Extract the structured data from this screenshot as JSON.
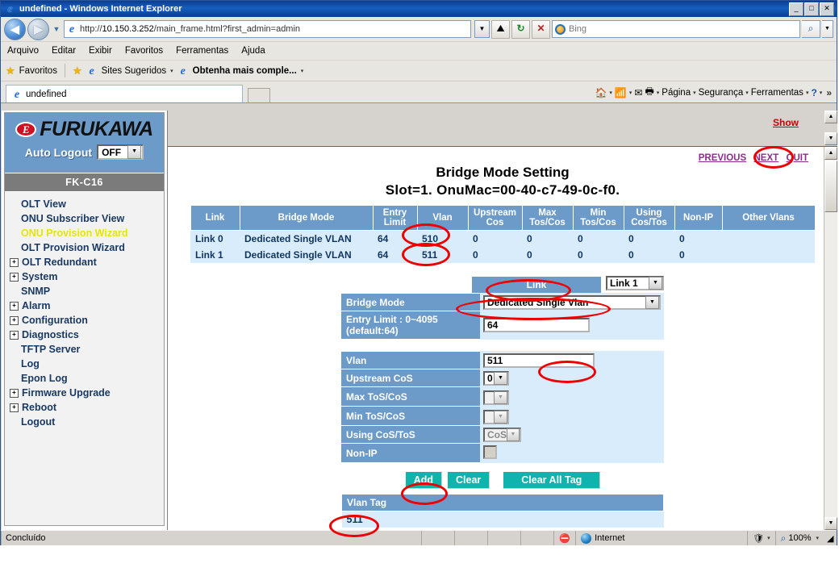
{
  "window": {
    "title": "undefined - Windows Internet Explorer",
    "buttons": {
      "minimize": "_",
      "maximize": "□",
      "close": "✕"
    }
  },
  "nav": {
    "back_glyph": "◀",
    "forward_glyph": "▶",
    "history_caret": "▼",
    "url_scheme": "http://",
    "url_host": "10.150.3.252",
    "url_path": "/main_frame.html?first_admin=admin",
    "address_caret": "▼",
    "compat_icon": "compatibility-view-icon",
    "refresh_glyph": "↻",
    "stop_glyph": "✕",
    "search_placeholder": "Bing",
    "search_go_glyph": "🔍",
    "search_caret": "▼"
  },
  "menubar": [
    {
      "label": "Arquivo",
      "accel": "A"
    },
    {
      "label": "Editar",
      "accel": "E"
    },
    {
      "label": "Exibir",
      "accel": "x"
    },
    {
      "label": "Favoritos",
      "accel": "F"
    },
    {
      "label": "Ferramentas",
      "accel": "r"
    },
    {
      "label": "Ajuda",
      "accel": "u"
    }
  ],
  "favbar": {
    "favorites_label": "Favoritos",
    "suggested_sites": "Sites Sugeridos",
    "get_more": "Obtenha mais comple...",
    "caret": "▾"
  },
  "tabs": {
    "active_label": "undefined",
    "new_tab_title": ""
  },
  "commandbar": {
    "home": "home-icon",
    "feeds": "feeds-icon",
    "read_mail": "mail-icon",
    "print": "print-icon",
    "page": "Página",
    "security": "Segurança",
    "tools": "Ferramentas",
    "help": "?",
    "overflow": "»",
    "caret": "▾"
  },
  "sidebar": {
    "brand": "FURUKAWA",
    "brand_badge": "E",
    "auto_logout_label": "Auto Logout",
    "auto_logout_value": "OFF",
    "model": "FK-C16",
    "items": [
      {
        "label": "OLT View",
        "expandable": false,
        "active": false
      },
      {
        "label": "ONU Subscriber View",
        "expandable": false,
        "active": false
      },
      {
        "label": "ONU Provision Wizard",
        "expandable": false,
        "active": true
      },
      {
        "label": "OLT Provision Wizard",
        "expandable": false,
        "active": false
      },
      {
        "label": "OLT Redundant",
        "expandable": true,
        "active": false
      },
      {
        "label": "System",
        "expandable": true,
        "active": false
      },
      {
        "label": "SNMP",
        "expandable": false,
        "active": false
      },
      {
        "label": "Alarm",
        "expandable": true,
        "active": false
      },
      {
        "label": "Configuration",
        "expandable": true,
        "active": false
      },
      {
        "label": "Diagnostics",
        "expandable": true,
        "active": false
      },
      {
        "label": "TFTP Server",
        "expandable": false,
        "active": false
      },
      {
        "label": "Log",
        "expandable": false,
        "active": false
      },
      {
        "label": "Epon Log",
        "expandable": false,
        "active": false
      },
      {
        "label": "Firmware Upgrade",
        "expandable": true,
        "active": false
      },
      {
        "label": "Reboot",
        "expandable": true,
        "active": false
      },
      {
        "label": "Logout",
        "expandable": false,
        "active": false
      }
    ]
  },
  "main": {
    "show_link": "Show",
    "pagelinks": {
      "previous": "PREVIOUS",
      "next": "NEXT",
      "quit": "QUIT"
    },
    "heading": "Bridge Mode Setting",
    "subheading": "Slot=1.  OnuMac=00-40-c7-49-0c-f0.",
    "table": {
      "headers": [
        "Link",
        "Bridge Mode",
        "Entry Limit",
        "Vlan",
        "Upstream Cos",
        "Max Tos/Cos",
        "Min Tos/Cos",
        "Using Cos/Tos",
        "Non-IP",
        "Other Vlans"
      ],
      "rows": [
        [
          "Link 0",
          "Dedicated Single VLAN",
          "64",
          "510",
          "0",
          "0",
          "0",
          "0",
          "0",
          ""
        ],
        [
          "Link 1",
          "Dedicated Single VLAN",
          "64",
          "511",
          "0",
          "0",
          "0",
          "0",
          "0",
          ""
        ]
      ]
    },
    "form": {
      "link_label": "Link",
      "link_value": "Link 1",
      "bridge_mode_label": "Bridge Mode",
      "bridge_mode_value": "Dedicated Single Vlan",
      "entry_limit_label_1": "Entry Limit : 0~4095",
      "entry_limit_label_2": "(default:64)",
      "entry_limit_value": "64",
      "vlan_label": "Vlan",
      "vlan_value": "511",
      "upstream_cos_label": "Upstream CoS",
      "upstream_cos_value": "0",
      "max_tos_label": "Max ToS/CoS",
      "max_tos_value": "",
      "min_tos_label": "Min ToS/CoS",
      "min_tos_value": "",
      "using_cos_label": "Using CoS/ToS",
      "using_cos_value": "CoS",
      "nonip_label": "Non-IP",
      "nonip_checked": false,
      "caret": "▼"
    },
    "buttons": {
      "add": "Add",
      "clear": "Clear",
      "clear_all_tag": "Clear All Tag"
    },
    "vlantag": {
      "header": "Vlan Tag",
      "value": "511"
    }
  },
  "statusbar": {
    "text": "Concluído",
    "zone": "Internet",
    "zoom": "100%",
    "protected_caret": "▾",
    "zoom_caret": "▾"
  },
  "colors": {
    "accent_blue": "#6d9bc9",
    "row_blue": "#d9ecfb",
    "teal_button": "#0fb5ad",
    "active_nav": "#e6e600",
    "annotation_red": "#ee0000",
    "link_purple": "#8e2b8e"
  }
}
